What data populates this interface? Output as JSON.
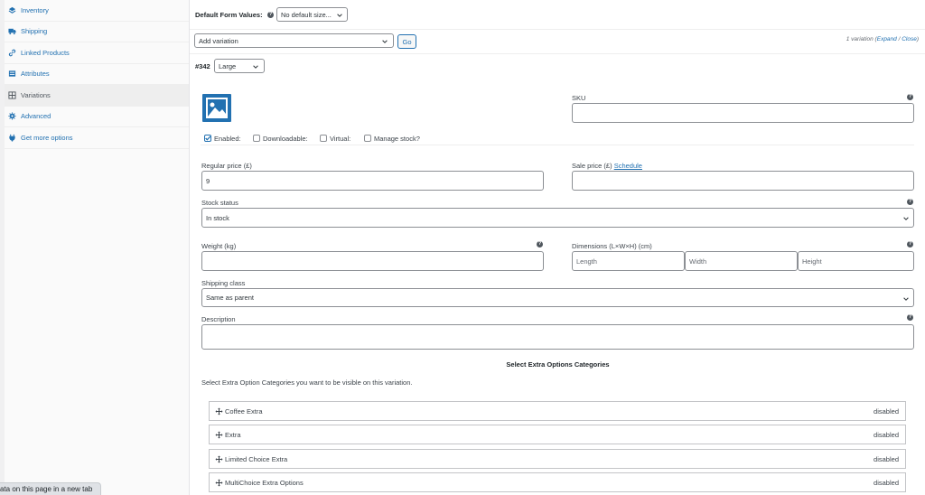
{
  "sidebar": {
    "items": [
      {
        "label": "Inventory",
        "icon": "inventory-icon"
      },
      {
        "label": "Shipping",
        "icon": "truck-icon"
      },
      {
        "label": "Linked Products",
        "icon": "link-icon"
      },
      {
        "label": "Attributes",
        "icon": "list-icon"
      },
      {
        "label": "Variations",
        "icon": "grid-icon",
        "active": true
      },
      {
        "label": "Advanced",
        "icon": "gear-icon"
      },
      {
        "label": "Get more options",
        "icon": "plugin-icon"
      }
    ]
  },
  "default_form": {
    "label": "Default Form Values:",
    "select_value": "No default size..."
  },
  "add_variation": {
    "select_value": "Add variation",
    "go_label": "Go",
    "count_text": "1 variation (",
    "expand": "Expand",
    "sep": " / ",
    "close": "Close",
    "count_end": ")"
  },
  "variation": {
    "id": "#342",
    "size": "Large",
    "sku_label": "SKU",
    "sku_value": "",
    "enabled_label": "Enabled:",
    "downloadable_label": "Downloadable:",
    "virtual_label": "Virtual:",
    "manage_stock_label": "Manage stock?",
    "regular_price_label": "Regular price (£)",
    "regular_price_value": "9",
    "sale_price_label": "Sale price (£)",
    "schedule_link": "Schedule",
    "sale_price_value": "",
    "stock_status_label": "Stock status",
    "stock_status_value": "In stock",
    "weight_label": "Weight (kg)",
    "weight_value": "",
    "dimensions_label": "Dimensions (L×W×H) (cm)",
    "length_placeholder": "Length",
    "width_placeholder": "Width",
    "height_placeholder": "Height",
    "shipping_class_label": "Shipping class",
    "shipping_class_value": "Same as parent",
    "description_label": "Description",
    "description_value": ""
  },
  "extra_options": {
    "heading": "Select Extra Options Categories",
    "hint": "Select Extra Option Categories you want to be visible on this variation.",
    "rows": [
      {
        "name": "Coffee Extra",
        "status": "disabled"
      },
      {
        "name": "Extra",
        "status": "disabled"
      },
      {
        "name": "Limited Choice Extra",
        "status": "disabled"
      },
      {
        "name": "MultiChoice Extra Options",
        "status": "disabled"
      }
    ]
  },
  "status_bar": {
    "text": "ata on this page in a new tab"
  },
  "colors": {
    "link": "#2271b1",
    "border": "#8c8f94",
    "active_bg": "#eeeeee",
    "checkbox_check": "#2271b1"
  }
}
